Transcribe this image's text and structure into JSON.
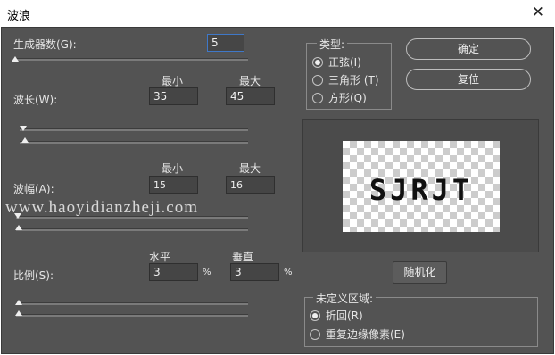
{
  "window": {
    "title": "波浪",
    "close_glyph": "✕"
  },
  "generators": {
    "label": "生成器数(G):",
    "value": "5",
    "slider_fraction": 0.0
  },
  "wavelength": {
    "label": "波长(W):",
    "min_label": "最小",
    "max_label": "最大",
    "min_value": "35",
    "max_value": "45"
  },
  "amplitude": {
    "label": "波幅(A):",
    "min_label": "最小",
    "max_label": "最大",
    "min_value": "15",
    "max_value": "16"
  },
  "scale": {
    "label": "比例(S):",
    "h_label": "水平",
    "v_label": "垂直",
    "h_value": "3",
    "v_value": "3",
    "unit": "%"
  },
  "type_group": {
    "title": "类型:",
    "options": [
      {
        "label": "正弦(I)",
        "selected": true
      },
      {
        "label": "三角形 (T)",
        "selected": false
      },
      {
        "label": "方形(Q)",
        "selected": false
      }
    ]
  },
  "buttons": {
    "ok": "确定",
    "reset": "复位",
    "randomize": "随机化"
  },
  "preview": {
    "text": "SJRJT"
  },
  "undefined_area": {
    "title": "未定义区域:",
    "options": [
      {
        "label": "折回(R)",
        "selected": true
      },
      {
        "label": "重复边缘像素(E)",
        "selected": false
      }
    ]
  },
  "watermark": "www.haoyidianzheji.com"
}
